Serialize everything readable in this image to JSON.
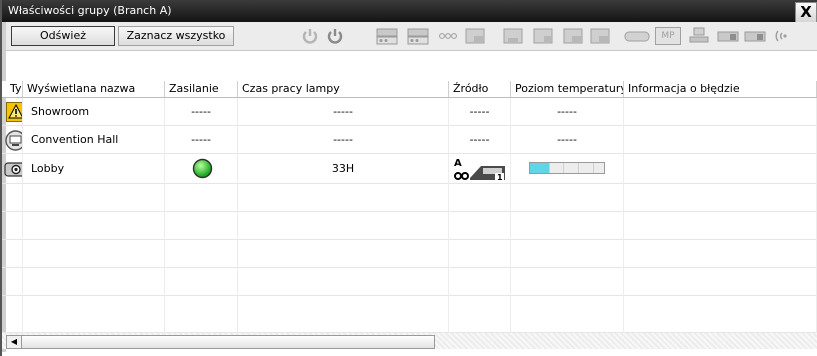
{
  "window": {
    "title": "Właściwości grupy (Branch A)",
    "close_label": "X"
  },
  "toolbar": {
    "refresh_label": "Odśwież",
    "select_all_label": "Zaznacz wszystko",
    "icons": [
      "power-off-icon",
      "power-on-icon",
      "input-1-icon",
      "input-2-icon",
      "dots-icon",
      "input-3-icon",
      "input-4-icon",
      "input-5-icon",
      "input-6-icon",
      "input-7-icon",
      "video-icon",
      "mp-icon",
      "network-icon",
      "freeze-1-icon",
      "freeze-2-icon",
      "wireless-icon"
    ],
    "mp_label": "MP"
  },
  "columns": [
    "Typ",
    "Wyświetlana nazwa",
    "Zasilanie",
    "Czas pracy lampy",
    "Źródło",
    "Poziom temperatury",
    "Informacja o błędzie"
  ],
  "rows": [
    {
      "type_icon": "warning-icon",
      "name": "Showroom",
      "power": "-----",
      "lamp": "-----",
      "source": "-----",
      "temperature": "-----",
      "error": ""
    },
    {
      "type_icon": "monitor-icon",
      "name": "Convention Hall",
      "power": "-----",
      "lamp": "-----",
      "source": "-----",
      "temperature": "-----",
      "error": ""
    },
    {
      "type_icon": "projector-icon",
      "name": "Lobby",
      "power_status": "on",
      "lamp": "33H",
      "source_tag": "A",
      "source_port": "1",
      "temperature_level": 0.25,
      "error": ""
    }
  ],
  "colors": {
    "power_on": "#22c933",
    "temperature_fill": "#5fd5e8",
    "warning": "#f5c400",
    "titlebar": "#2a2a2a"
  }
}
